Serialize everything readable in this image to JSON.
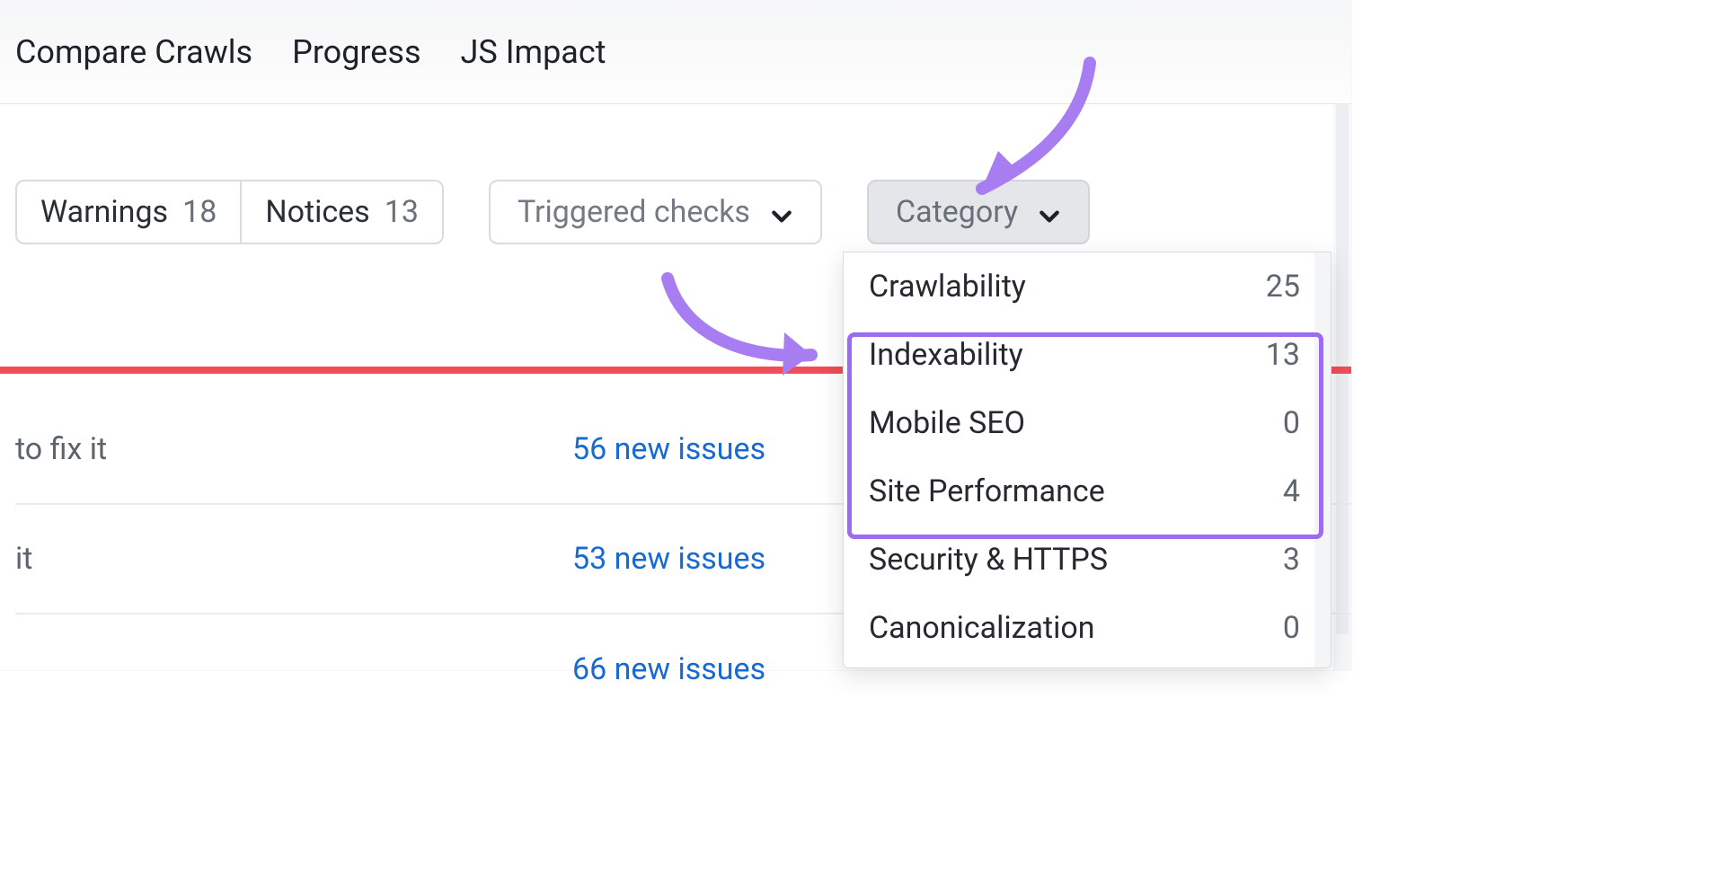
{
  "tabs": {
    "compare": "Compare Crawls",
    "progress": "Progress",
    "jsimpact": "JS Impact"
  },
  "filters": {
    "warnings_label": "Warnings",
    "warnings_count": "18",
    "notices_label": "Notices",
    "notices_count": "13",
    "triggered_label": "Triggered checks",
    "category_label": "Category"
  },
  "rows": [
    {
      "left": "to fix it",
      "link": "56 new issues"
    },
    {
      "left": "it",
      "link": "53 new issues"
    },
    {
      "left": "",
      "link": "66 new issues"
    }
  ],
  "categories": [
    {
      "name": "Crawlability",
      "count": "25"
    },
    {
      "name": "Indexability",
      "count": "13"
    },
    {
      "name": "Mobile SEO",
      "count": "0"
    },
    {
      "name": "Site Performance",
      "count": "4"
    },
    {
      "name": "Security & HTTPS",
      "count": "3"
    },
    {
      "name": "Canonicalization",
      "count": "0"
    }
  ],
  "colors": {
    "accent_purple": "#9b6cf0",
    "error_red": "#ef4d57",
    "link_blue": "#1769d3"
  }
}
